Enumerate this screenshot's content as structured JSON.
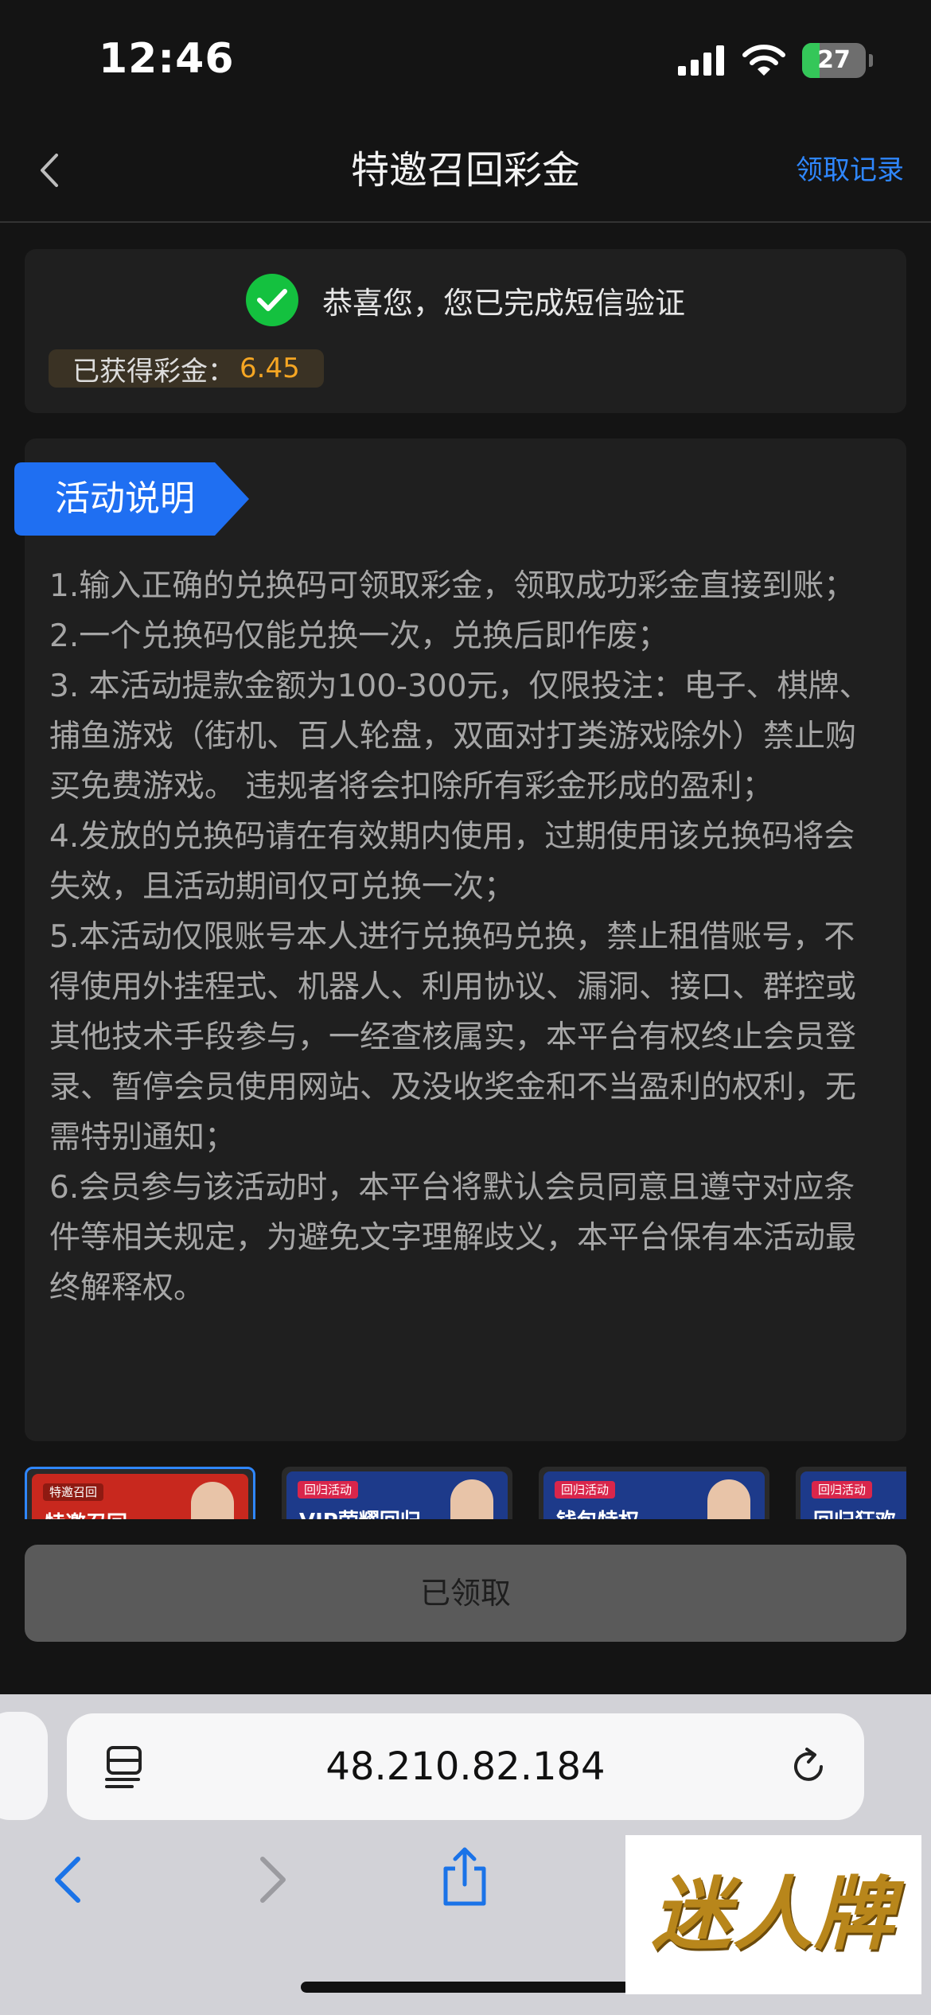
{
  "status_bar": {
    "time": "12:46",
    "battery_level": "27",
    "battery_percent": 27
  },
  "nav": {
    "title": "特邀召回彩金",
    "record_link": "领取记录",
    "back_icon": "chevron-left-icon"
  },
  "verify": {
    "message": "恭喜您，您已完成短信验证",
    "bonus_label": "已获得彩金：",
    "bonus_value": "6.45",
    "icon": "check-circle-icon"
  },
  "rules": {
    "tag": "活动说明",
    "items": [
      "1.输入正确的兑换码可领取彩金，领取成功彩金直接到账；",
      "2.一个兑换码仅能兑换一次，兑换后即作废；",
      "3. 本活动提款金额为100-300元，仅限投注：电子、棋牌、捕鱼游戏（街机、百人轮盘，双面对打类游戏除外）禁止购买免费游戏。 违规者将会扣除所有彩金形成的盈利；",
      "4.发放的兑换码请在有效期内使用，过期使用该兑换码将会失效，且活动期间仅可兑换一次；",
      "5.本活动仅限账号本人进行兑换码兑换，禁止租借账号，不得使用外挂程式、机器人、利用协议、漏洞、接口、群控或其他技术手段参与，一经查核属实，本平台有权终止会员登录、暂停会员使用网站、及没收奖金和不当盈利的权利，无需特别通知；",
      "6.会员参与该活动时，本平台将默认会员同意且遵守对应条件等相关规定，为避免文字理解歧义，本平台保有本活动最终解释权。"
    ]
  },
  "thumbnails": [
    {
      "tag": "特邀召回",
      "title": "特邀召回",
      "color": "#c8281e"
    },
    {
      "tag": "回归活动",
      "title": "VIP荣耀回归",
      "color": "#1d3a8a"
    },
    {
      "tag": "回归活动",
      "title": "钱包特权",
      "color": "#1d3a8a"
    },
    {
      "tag": "回归活动",
      "title": "回归狂欢",
      "color": "#1d3a8a"
    }
  ],
  "claimed_button": "已领取",
  "browser": {
    "url": "48.210.82.184"
  },
  "watermark": "迷人牌",
  "colors": {
    "accent": "#2f87ff",
    "bonus": "#f5a623",
    "success": "#14c13f"
  }
}
